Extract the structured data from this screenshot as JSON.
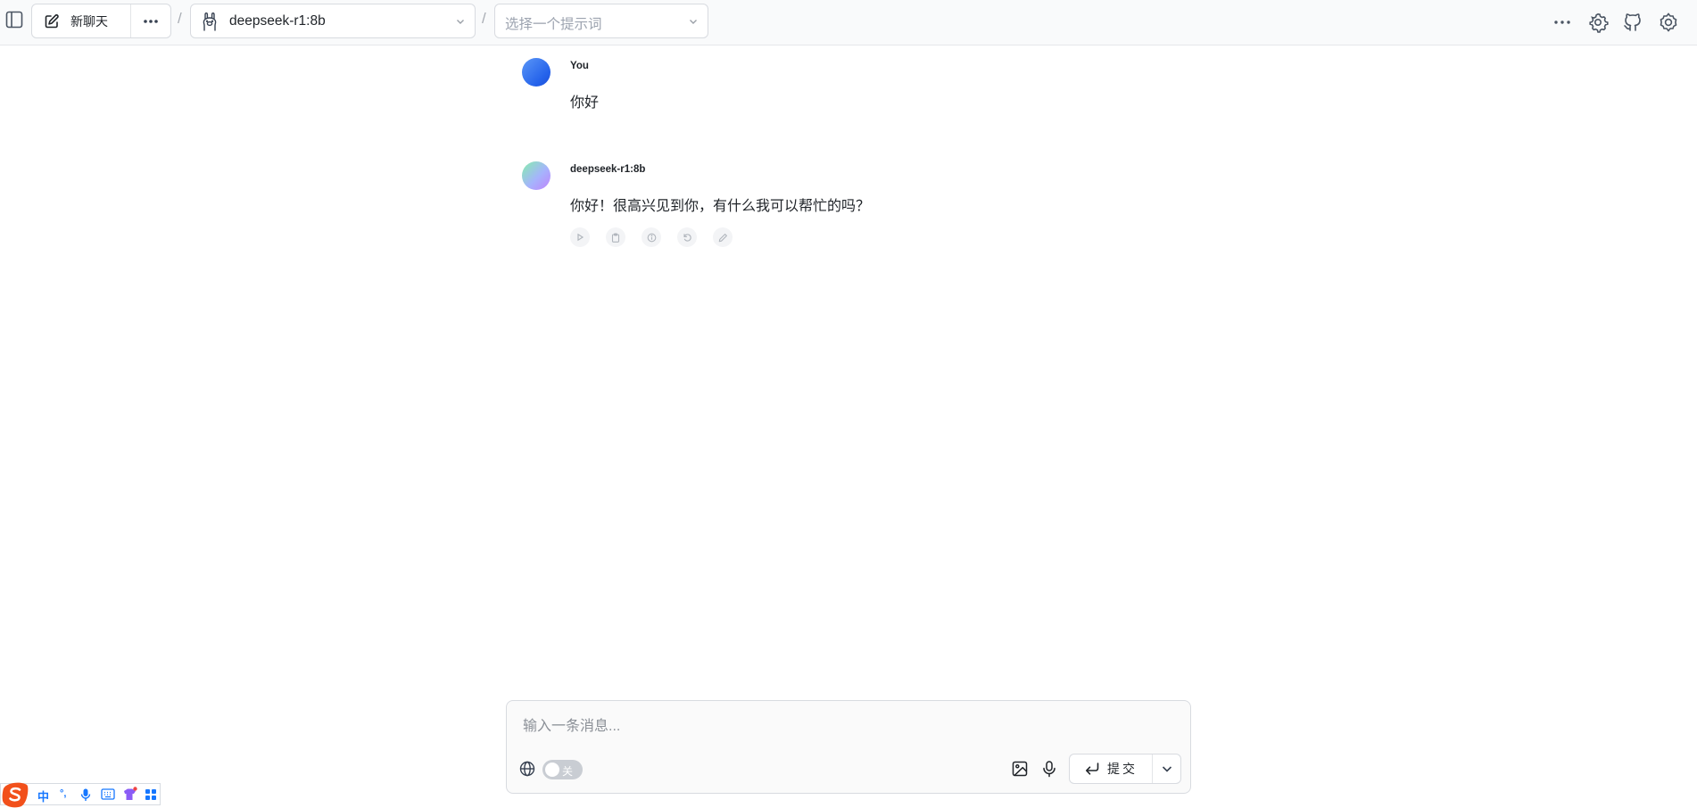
{
  "topbar": {
    "new_chat_label": "新聊天",
    "separator": "/",
    "model_name": "deepseek-r1:8b",
    "prompt_placeholder": "选择一个提示词"
  },
  "messages": [
    {
      "sender": "You",
      "text": "你好",
      "avatar_color": "#2563eb"
    },
    {
      "sender": "deepseek-r1:8b",
      "text": "你好！很高兴见到你，有什么我可以帮忙的吗？",
      "avatar_color": "#a5b4fc",
      "actions": [
        "play-icon",
        "copy-icon",
        "info-icon",
        "regenerate-icon",
        "edit-icon"
      ]
    }
  ],
  "composer": {
    "placeholder": "输入一条消息...",
    "web_toggle_label": "关",
    "web_toggle_on": false,
    "submit_label": "提交"
  },
  "ime": {
    "mode_label": "中",
    "punct_label": "°,"
  },
  "colors": {
    "accent": "#2563eb",
    "ime_brand": "#f2501b",
    "ime_blue": "#1677ff"
  }
}
